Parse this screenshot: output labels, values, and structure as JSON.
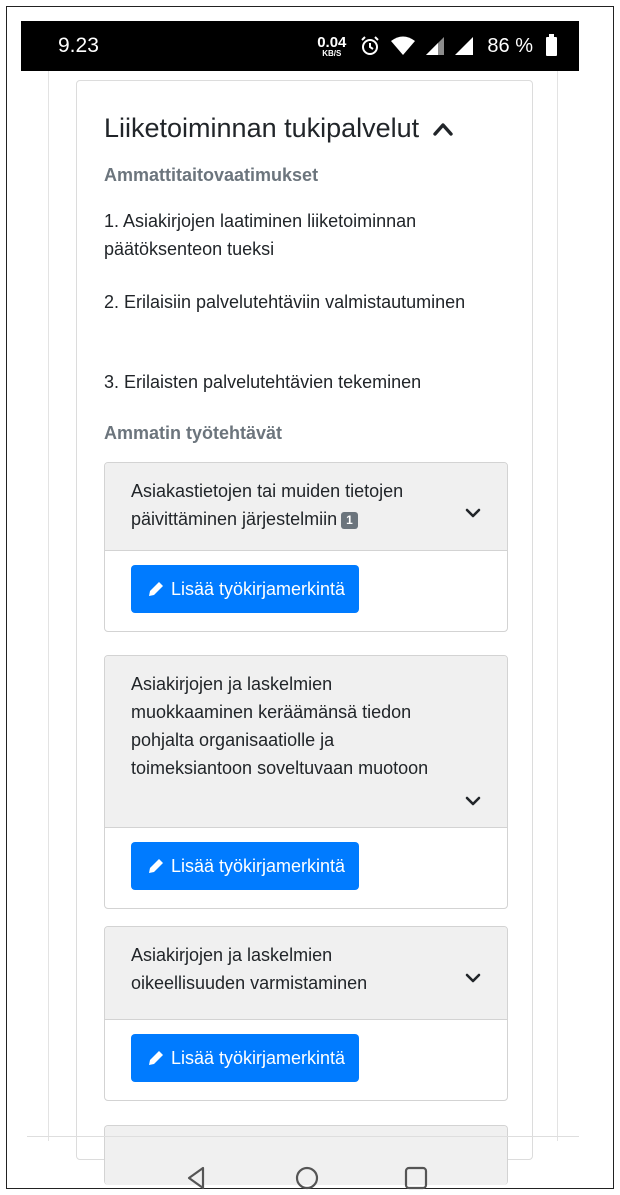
{
  "status_bar": {
    "time": "9.23",
    "net_speed_value": "0.04",
    "net_speed_unit": "KB/S",
    "battery": "86 %",
    "icons": [
      "alarm-icon",
      "wifi-icon",
      "signal-icon",
      "signal-icon",
      "battery-icon"
    ]
  },
  "section": {
    "title": "Liiketoiminnan tukipalvelut",
    "requirements_heading": "Ammattitaitovaatimukset",
    "requirements": [
      "1. Asiakirjojen laatiminen liiketoiminnan päätöksenteon tueksi",
      "2. Erilaisiin palvelutehtäviin valmistautuminen",
      "3. Erilaisten palvelutehtävien tekeminen"
    ],
    "tasks_heading": "Ammatin työtehtävät",
    "tasks": [
      {
        "title": "Asiakastietojen tai muiden tietojen päivittäminen järjestelmiin",
        "badge": "1",
        "button": "Lisää työkirjamerkintä"
      },
      {
        "title": "Asiakirjojen ja laskelmien muokkaaminen keräämänsä tiedon pohjalta organisaatiolle ja toimeksiantoon soveltuvaan muotoon",
        "badge": "",
        "button": "Lisää työkirjamerkintä"
      },
      {
        "title": "Asiakirjojen ja laskelmien oikeellisuuden varmistaminen",
        "badge": "",
        "button": "Lisää työkirjamerkintä"
      }
    ]
  },
  "colors": {
    "primary_button": "#007bff",
    "muted_text": "#6c757d",
    "card_header_bg": "#f0f0f0"
  },
  "nav_bar": [
    "back-icon",
    "home-icon",
    "recents-icon"
  ]
}
